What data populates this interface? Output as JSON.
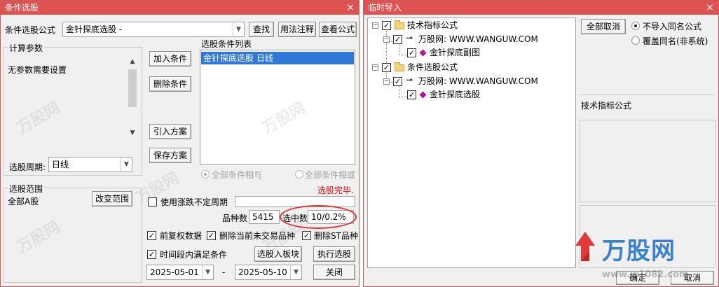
{
  "w1": {
    "title": "条件选股",
    "close": "×",
    "formula_label": "条件选股公式",
    "formula_value": "金针探底选股  -",
    "btn_find": "查找",
    "btn_usage": "用法注释",
    "btn_view": "查看公式",
    "calc_group": "计算参数",
    "no_params": "无参数需要设置",
    "period_label": "选股周期:",
    "period_value": "日线",
    "btn_add": "加入条件",
    "btn_delete": "删除条件",
    "btn_import": "引入方案",
    "btn_save": "保存方案",
    "cond_list_label": "选股条件列表",
    "cond_item": "金针探底选股  日线",
    "radio_and": "全部条件相与",
    "radio_or": "全部条件相或",
    "status": "选股完毕.",
    "range_group": "选股范围",
    "range_value": "全部A股",
    "btn_range": "改变范围",
    "use_period": "使用涨跌不定周期",
    "count_label": "品种数",
    "count_value": "5415",
    "selected_label": "选中数",
    "selected_value": "10/0.2%",
    "fq": "前复权数据",
    "rm_untraded": "删除当前未交易品种",
    "rm_st": "删除ST品种",
    "time_cond": "时间段内满足条件",
    "btn_to_block": "选股入板块",
    "btn_execute": "执行选股",
    "date_from": "2025-05-01",
    "date_sep": "-",
    "date_to": "2025-05-10",
    "btn_close": "关闭"
  },
  "w2": {
    "title": "临时导入",
    "close": "×",
    "tree": {
      "tech_folder": "技术指标公式",
      "tech_site": "万股网: WWW.WANGUW.COM",
      "tech_item": "金针探底副图",
      "cond_folder": "条件选股公式",
      "cond_site": "万股网: WWW.WANGUW.COM",
      "cond_item": "金针探底选股"
    },
    "btn_cancel_all": "全部取消",
    "opt_no_import": "不导入同名公式",
    "opt_overwrite": "覆盖同名(非系统)",
    "info_label": "技术指标公式",
    "btn_ok": "确定",
    "btn_cancel": "取消"
  },
  "watermark": {
    "brand": "万股网",
    "site": "www.w1082.com",
    "small": "万股网"
  }
}
